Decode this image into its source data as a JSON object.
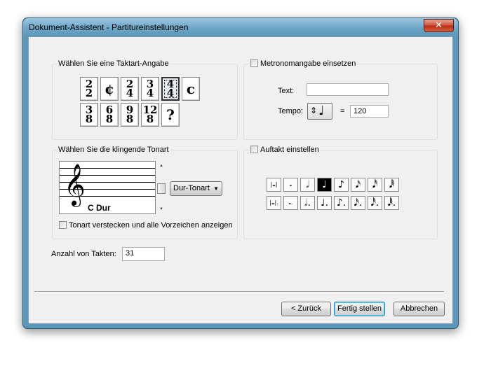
{
  "window": {
    "title": "Dokument-Assistent - Partitureinstellungen",
    "close": "✕"
  },
  "time_signature": {
    "label": "Wählen Sie eine Taktart-Angabe",
    "row1": [
      {
        "top": "2",
        "bottom": "2"
      },
      {
        "single": "¢"
      },
      {
        "top": "2",
        "bottom": "4"
      },
      {
        "top": "3",
        "bottom": "4"
      },
      {
        "top": "4",
        "bottom": "4"
      },
      {
        "single": "c"
      }
    ],
    "row2": [
      {
        "top": "3",
        "bottom": "8"
      },
      {
        "top": "6",
        "bottom": "8"
      },
      {
        "top": "9",
        "bottom": "8"
      },
      {
        "top": "12",
        "bottom": "8"
      },
      {
        "single": "?"
      }
    ]
  },
  "metronome": {
    "checkbox_label": "Metronomangabe einsetzen",
    "text_label": "Text:",
    "text_value": "",
    "tempo_label": "Tempo:",
    "equals": "=",
    "tempo_value": "120",
    "stepper": "⇕",
    "note": "♩"
  },
  "key": {
    "label": "Wählen Sie die klingende Tonart",
    "clef": "𝄞",
    "key_name": "C Dur",
    "mode_select": "Dur-Tonart",
    "scroll_up": "▲",
    "scroll_down": "▼",
    "select_arrow": "▼",
    "hide_checkbox_label": "Tonart verstecken und alle Vorzeichen anzeigen"
  },
  "pickup": {
    "checkbox_label": "Auftakt einstellen",
    "row1": [
      "|𝅜|",
      "𝅝",
      "𝅗𝅥",
      "♩",
      "♪",
      "𝅘𝅥𝅯",
      "𝅘𝅥𝅰",
      "𝅘𝅥𝅱"
    ],
    "row2": [
      "|𝅜|.",
      "𝅝.",
      "𝅗𝅥.",
      "♩.",
      "♪.",
      "𝅘𝅥𝅯.",
      "𝅘𝅥𝅰.",
      "𝅘𝅥𝅱."
    ],
    "selected_index": 3
  },
  "measures": {
    "label": "Anzahl von Takten:",
    "value": "31"
  },
  "buttons": {
    "back": "< Zurück",
    "finish": "Fertig stellen",
    "cancel": "Abbrechen"
  }
}
